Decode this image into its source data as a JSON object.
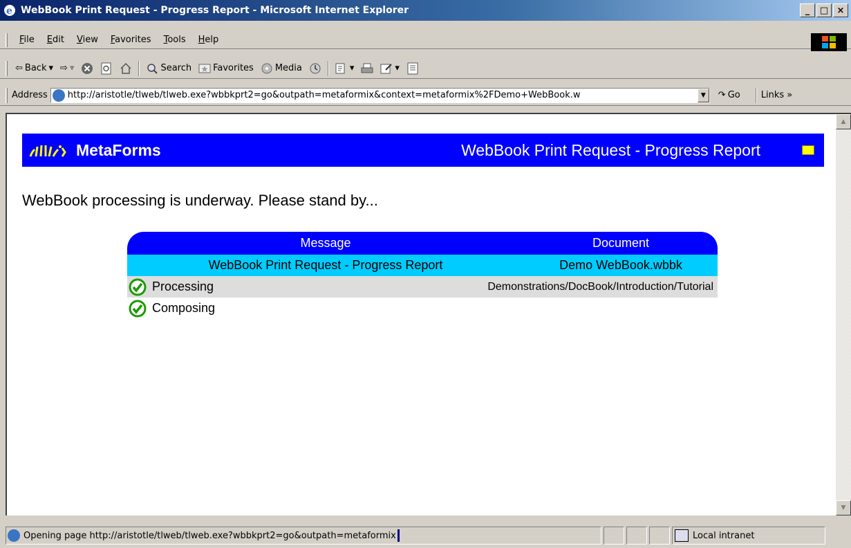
{
  "window": {
    "title": "WebBook Print Request - Progress Report - Microsoft Internet Explorer",
    "minimize": "_",
    "maximize": "□",
    "close": "×"
  },
  "menu": [
    "File",
    "Edit",
    "View",
    "Favorites",
    "Tools",
    "Help"
  ],
  "toolbar": {
    "back": "Back",
    "search": "Search",
    "favorites": "Favorites",
    "media": "Media"
  },
  "address": {
    "label": "Address",
    "url": "http://aristotle/tlweb/tlweb.exe?wbbkprt2=go&outpath=metaformix&context=metaformix%2FDemo+WebBook.w",
    "go": "Go",
    "links": "Links »"
  },
  "page": {
    "logo": "MetaForms",
    "banner_title": "WebBook Print Request - Progress Report",
    "standby": "WebBook processing is underway. Please stand by...",
    "table": {
      "headers": [
        "Message",
        "Document"
      ],
      "title_row": [
        "WebBook Print Request - Progress Report",
        "Demo WebBook.wbbk"
      ],
      "rows": [
        {
          "label": "Processing",
          "doc": "Demonstrations/DocBook/Introduction/Tutorial"
        },
        {
          "label": "Composing",
          "doc": ""
        }
      ]
    }
  },
  "status": {
    "text": "Opening page http://aristotle/tlweb/tlweb.exe?wbbkprt2=go&outpath=metaformix",
    "zone": "Local intranet"
  },
  "colors": {
    "banner": "#0000ff",
    "title_row": "#00ccff",
    "row_grey": "#dddddd",
    "check": "#1a9a00"
  }
}
